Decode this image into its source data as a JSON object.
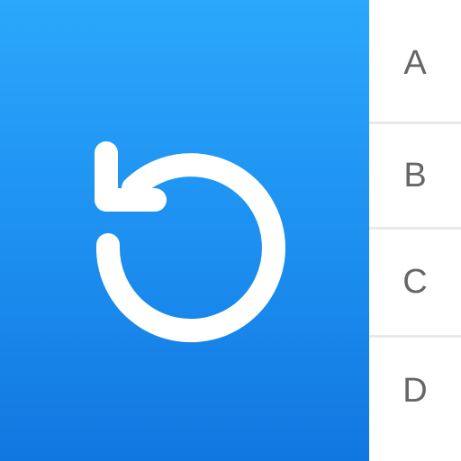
{
  "app": {
    "action_icon": "undo-icon",
    "accent_color": "#1c8ef0",
    "icon_color": "#ffffff"
  },
  "index": {
    "items": [
      {
        "label": "A"
      },
      {
        "label": "B"
      },
      {
        "label": "C"
      },
      {
        "label": "D"
      }
    ],
    "text_color": "#666666",
    "divider_color": "#e9e9e9"
  }
}
